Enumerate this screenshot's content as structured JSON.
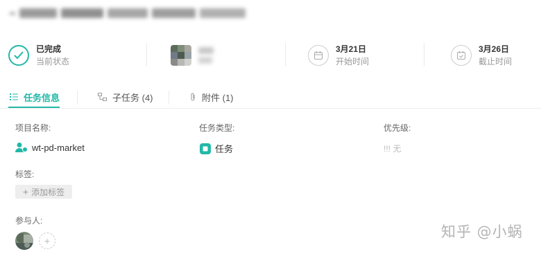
{
  "colors": {
    "accent": "#22b8a7",
    "priority_icon": "#cccccc",
    "tag_bg": "#eeeeee"
  },
  "info_bar": {
    "status": {
      "value": "已完成",
      "label": "当前状态",
      "icon": "check-circle-icon"
    },
    "assignee": {
      "icon": "avatar"
    },
    "start": {
      "value": "3月21日",
      "label": "开始时间",
      "icon": "calendar-icon"
    },
    "due": {
      "value": "3月26日",
      "label": "截止时间",
      "icon": "calendar-check-icon"
    }
  },
  "tabs": [
    {
      "label": "任务信息",
      "icon": "list-icon",
      "active": true
    },
    {
      "label": "子任务 (4)",
      "icon": "subtask-icon",
      "active": false
    },
    {
      "label": "附件 (1)",
      "icon": "paperclip-icon",
      "active": false
    }
  ],
  "fields": {
    "project": {
      "label": "项目名称:",
      "value": "wt-pd-market",
      "icon": "project-user-icon"
    },
    "type": {
      "label": "任务类型:",
      "value": "任务",
      "icon": "task-type-icon"
    },
    "priority": {
      "label": "优先级:",
      "value": "!!! 无"
    }
  },
  "tags": {
    "label": "标签:",
    "add_label": "添加标签"
  },
  "members": {
    "label": "参与人:",
    "add_icon": "plus-icon"
  },
  "watermark": "知乎 @小蜗"
}
